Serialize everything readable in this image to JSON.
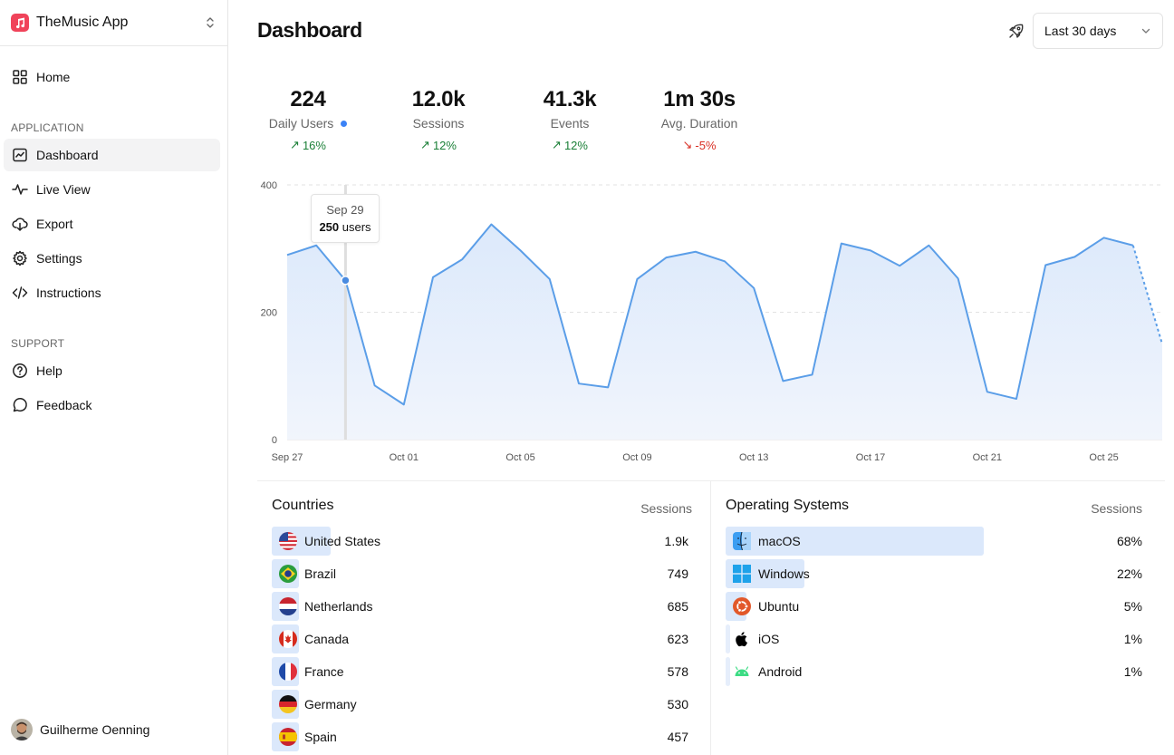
{
  "app": {
    "name": "TheMusic App"
  },
  "sidebar": {
    "home": "Home",
    "section_application": "APPLICATION",
    "items": [
      "Dashboard",
      "Live View",
      "Export",
      "Settings",
      "Instructions"
    ],
    "section_support": "SUPPORT",
    "support_items": [
      "Help",
      "Feedback"
    ],
    "user": "Guilherme Oenning"
  },
  "header": {
    "title": "Dashboard",
    "range": "Last 30 days"
  },
  "stats": [
    {
      "value": "224",
      "label": "Daily Users",
      "change": "16%",
      "trend": "up"
    },
    {
      "value": "12.0k",
      "label": "Sessions",
      "change": "12%",
      "trend": "up"
    },
    {
      "value": "41.3k",
      "label": "Events",
      "change": "12%",
      "trend": "up"
    },
    {
      "value": "1m 30s",
      "label": "Avg. Duration",
      "change": "-5%",
      "trend": "down"
    }
  ],
  "tooltip": {
    "date": "Sep 29",
    "value": "250",
    "unit": "users"
  },
  "chart_data": {
    "type": "area",
    "x": [
      "Sep 27",
      "Sep 28",
      "Sep 29",
      "Sep 30",
      "Oct 01",
      "Oct 02",
      "Oct 03",
      "Oct 04",
      "Oct 05",
      "Oct 06",
      "Oct 07",
      "Oct 08",
      "Oct 09",
      "Oct 10",
      "Oct 11",
      "Oct 12",
      "Oct 13",
      "Oct 14",
      "Oct 15",
      "Oct 16",
      "Oct 17",
      "Oct 18",
      "Oct 19",
      "Oct 20",
      "Oct 21",
      "Oct 22",
      "Oct 23",
      "Oct 24",
      "Oct 25",
      "Oct 26",
      "Oct 27"
    ],
    "values": [
      290,
      305,
      250,
      85,
      55,
      255,
      283,
      338,
      297,
      252,
      88,
      82,
      252,
      286,
      295,
      280,
      238,
      92,
      102,
      308,
      297,
      273,
      305,
      253,
      75,
      64,
      274,
      287,
      317,
      305,
      150
    ],
    "last_point_projected": true,
    "yticks": [
      0,
      200,
      400
    ],
    "ylim": [
      0,
      400
    ],
    "xtick_labels": [
      "Sep 27",
      "Oct 01",
      "Oct 05",
      "Oct 09",
      "Oct 13",
      "Oct 17",
      "Oct 21",
      "Oct 25"
    ],
    "grid": "horizontal dashed",
    "highlight_index": 2,
    "color": "#5b9ee8"
  },
  "countries": {
    "title": "Countries",
    "column": "Sessions",
    "rows": [
      {
        "name": "United States",
        "value": "1.9k",
        "share": 0.13,
        "flag": "us-flag-icon"
      },
      {
        "name": "Brazil",
        "value": "749",
        "share": 0.06,
        "flag": "brazil-flag-icon"
      },
      {
        "name": "Netherlands",
        "value": "685",
        "share": 0.06,
        "flag": "netherlands-flag-icon"
      },
      {
        "name": "Canada",
        "value": "623",
        "share": 0.06,
        "flag": "canada-flag-icon"
      },
      {
        "name": "France",
        "value": "578",
        "share": 0.06,
        "flag": "france-flag-icon"
      },
      {
        "name": "Germany",
        "value": "530",
        "share": 0.06,
        "flag": "germany-flag-icon"
      },
      {
        "name": "Spain",
        "value": "457",
        "share": 0.06,
        "flag": "spain-flag-icon"
      }
    ]
  },
  "os": {
    "title": "Operating Systems",
    "column": "Sessions",
    "rows": [
      {
        "name": "macOS",
        "value": "68%",
        "share": 0.62,
        "icon": "macos-finder-icon"
      },
      {
        "name": "Windows",
        "value": "22%",
        "share": 0.19,
        "icon": "windows-icon"
      },
      {
        "name": "Ubuntu",
        "value": "5%",
        "share": 0.05,
        "icon": "ubuntu-icon"
      },
      {
        "name": "iOS",
        "value": "1%",
        "share": 0.01,
        "icon": "apple-icon"
      },
      {
        "name": "Android",
        "value": "1%",
        "share": 0.01,
        "icon": "android-icon"
      }
    ]
  }
}
